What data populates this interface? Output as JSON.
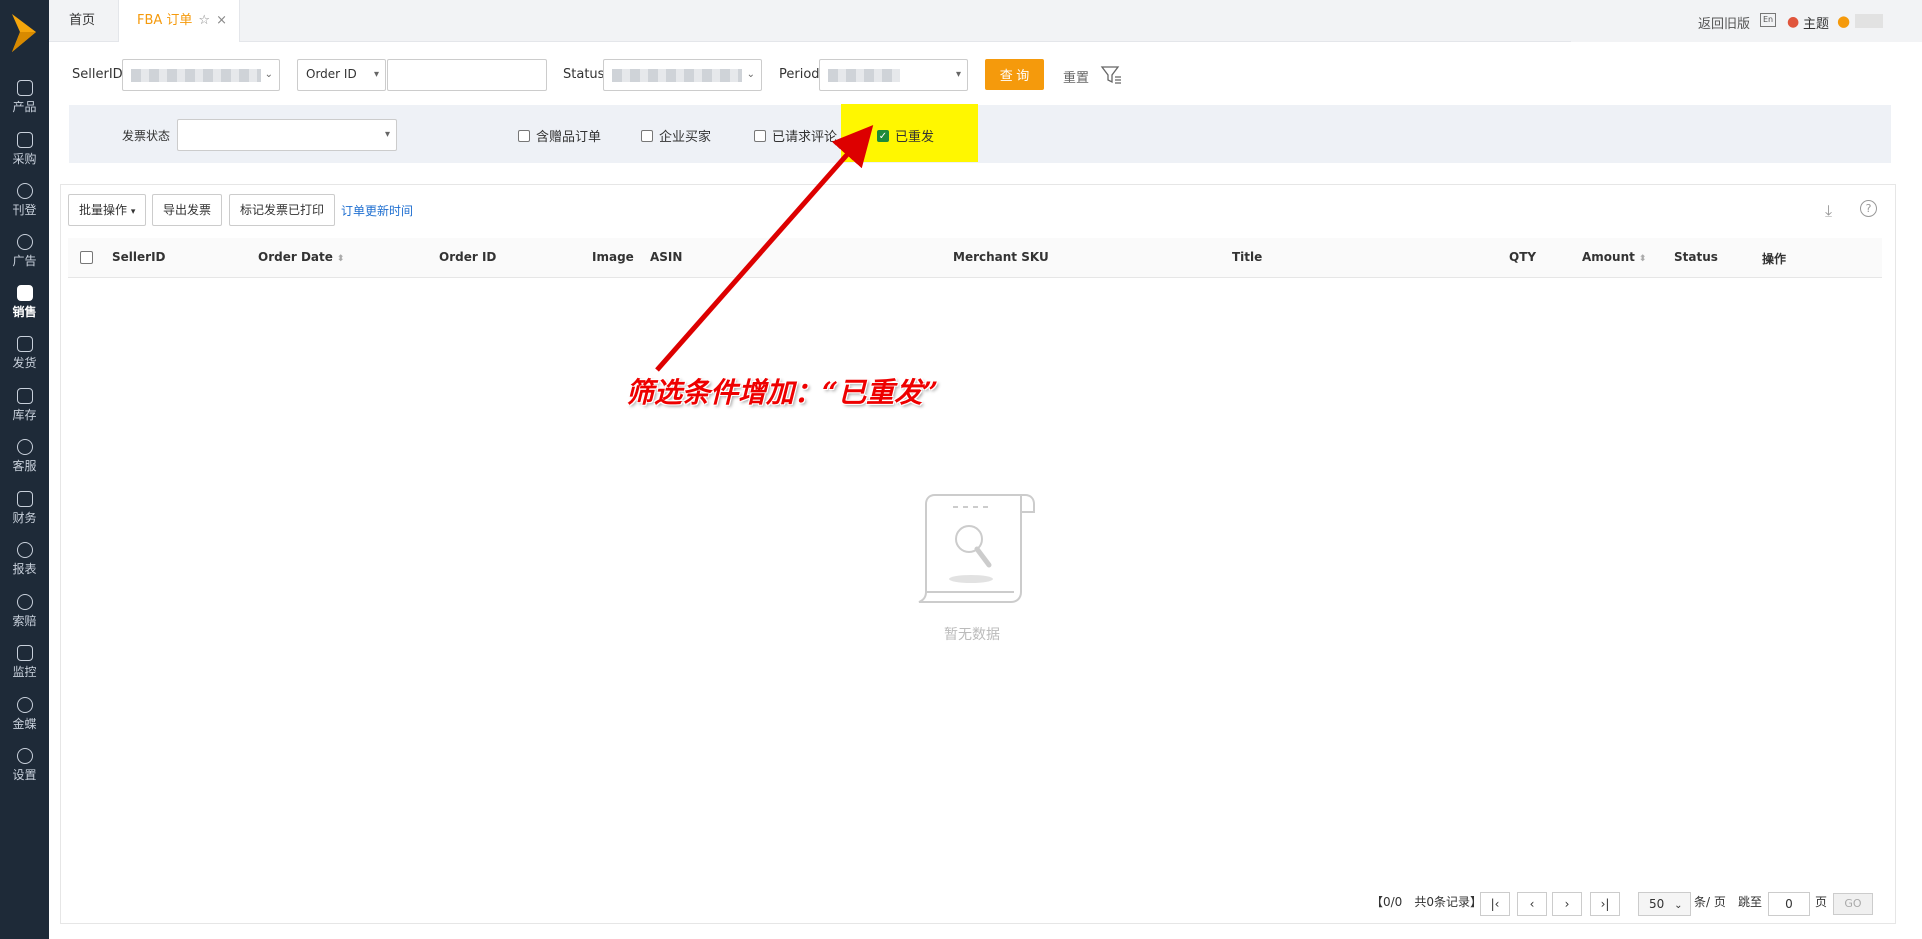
{
  "sidebar": {
    "items": [
      {
        "label": "产品",
        "icon": "lock-icon"
      },
      {
        "label": "采购",
        "icon": "cart-icon"
      },
      {
        "label": "刊登",
        "icon": "upload-icon"
      },
      {
        "label": "广告",
        "icon": "ad-icon"
      },
      {
        "label": "销售",
        "icon": "sales-icon"
      },
      {
        "label": "发货",
        "icon": "truck-icon"
      },
      {
        "label": "库存",
        "icon": "warehouse-icon"
      },
      {
        "label": "客服",
        "icon": "headset-icon"
      },
      {
        "label": "财务",
        "icon": "finance-icon"
      },
      {
        "label": "报表",
        "icon": "pie-icon"
      },
      {
        "label": "索赔",
        "icon": "shield-icon"
      },
      {
        "label": "监控",
        "icon": "monitor-icon"
      },
      {
        "label": "金蝶",
        "icon": "kingdee-icon"
      },
      {
        "label": "设置",
        "icon": "gear-icon"
      }
    ]
  },
  "tabs": {
    "home": "首页",
    "fba": "FBA 订单"
  },
  "topRight": {
    "old_version": "返回旧版",
    "lang": "En",
    "theme": "主题"
  },
  "filters": {
    "seller_label": "SellerID",
    "order_id_select": "Order ID",
    "status_label": "Status",
    "period_label": "Period",
    "query_button": "查 询",
    "reset_button": "重置",
    "invoice_status_label": "发票状态",
    "checkbox_gift": "含赠品订单",
    "checkbox_business": "企业买家",
    "checkbox_review": "已请求评论",
    "checkbox_resent": "已重发",
    "resent_checked": true
  },
  "toolbar": {
    "batch": "批量操作",
    "export_invoice": "导出发票",
    "mark_printed": "标记发票已打印",
    "order_update_time": "订单更新时间"
  },
  "table": {
    "columns": [
      "SellerID",
      "Order Date",
      "Order ID",
      "Image",
      "ASIN",
      "Merchant SKU",
      "Title",
      "QTY",
      "Amount",
      "Status",
      "操作"
    ],
    "empty_text": "暂无数据"
  },
  "pagination": {
    "summary": "【0/0　共0条记录】",
    "page_size": "50",
    "per_page": "条/ 页",
    "jump_to": "跳至",
    "page_input": "0",
    "page_unit": "页",
    "go": "GO"
  },
  "annotation": {
    "text": "筛选条件增加：“已重发”",
    "color": "#e00000"
  },
  "colors": {
    "accent": "#f59a0c",
    "sidebar": "#1e2a38",
    "highlight": "#fff700",
    "link": "#1f6fd0"
  }
}
